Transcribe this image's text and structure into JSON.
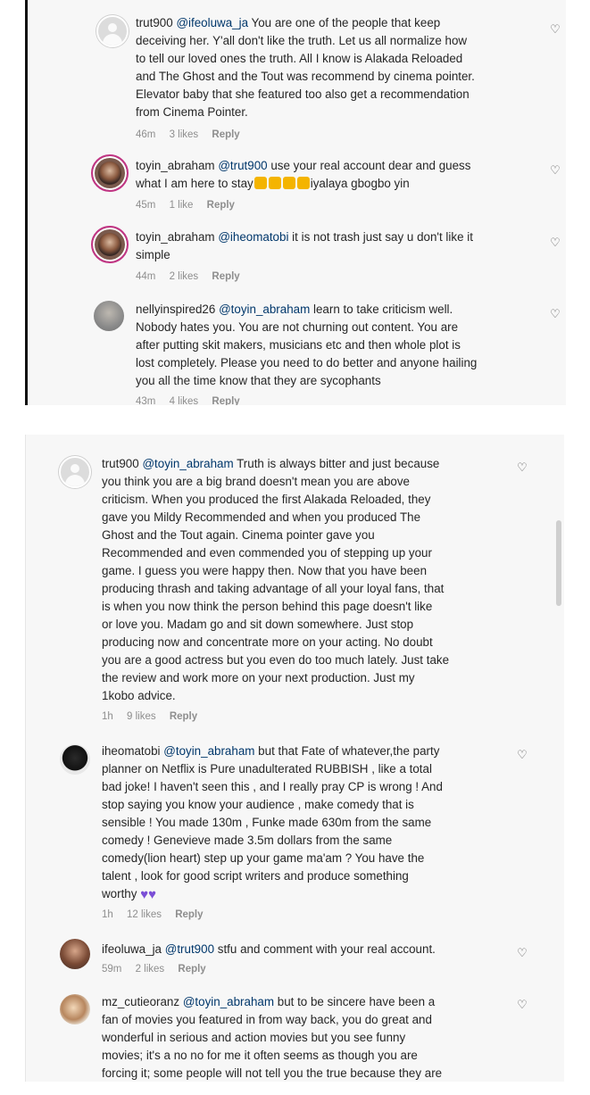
{
  "top_comments": [
    {
      "username": "trut900",
      "mention": "@ifeoluwa_ja",
      "lines": [
        "You are one of the people that keep",
        "deceiving her. Y'all don't like the truth. Let us all normalize how",
        "to tell our loved ones the truth. All I know is Alakada Reloaded",
        "and The Ghost and the Tout was recommend by cinema pointer.",
        "Elevator baby that she featured too also get a recommendation",
        "from Cinema Pointer."
      ],
      "time": "46m",
      "likes": "3 likes",
      "reply": "Reply"
    },
    {
      "username": "toyin_abraham",
      "mention": "@trut900",
      "lines": [
        "use your real account dear and guess",
        "what I am here to stay",
        "iyalaya gbogbo yin"
      ],
      "time": "45m",
      "likes": "1 like",
      "reply": "Reply"
    },
    {
      "username": "toyin_abraham",
      "mention": "@iheomatobi",
      "lines": [
        "it is not trash just say u don't like it",
        "simple"
      ],
      "time": "44m",
      "likes": "2 likes",
      "reply": "Reply"
    },
    {
      "username": "nellyinspired26",
      "mention": "@toyin_abraham",
      "lines": [
        "learn to take criticism well.",
        "Nobody hates you. You are not churning out content. You are",
        "after putting skit makers, musicians etc and then whole plot is",
        "lost completely. Please you need to do better and anyone hailing",
        "you all the time know that they are sycophants"
      ],
      "time": "43m",
      "likes": "4 likes",
      "reply": "Reply"
    }
  ],
  "bottom_comments": [
    {
      "username": "trut900",
      "mention": "@toyin_abraham",
      "lines": [
        "Truth is always bitter and just because",
        "you think you are a big brand doesn't mean you are above",
        "criticism. When you produced the first Alakada Reloaded, they",
        "gave you Mildy Recommended and when you produced The",
        "Ghost and the Tout again. Cinema pointer gave you",
        "Recommended and even commended you of stepping up your",
        "game. I guess you were happy then. Now that you have been",
        "producing thrash and taking advantage of all your loyal fans, that",
        "is when you now think the person behind this page doesn't like",
        "or love you. Madam go and sit down somewhere. Just stop",
        "producing now and concentrate more on your acting. No doubt",
        "you are a good actress but you even do too much lately. Just take",
        "the review and work more on your next production. Just my",
        "1kobo advice."
      ],
      "time": "1h",
      "likes": "9 likes",
      "reply": "Reply"
    },
    {
      "username": "iheomatobi",
      "mention": "@toyin_abraham",
      "lines": [
        "but that Fate of whatever,the party",
        "planner on Netflix is Pure unadulterated RUBBISH , like a total",
        "bad joke! I haven't seen this , and I really pray CP is wrong ! And",
        "stop saying you know your audience , make comedy that is",
        "sensible ! You made 130m , Funke made 630m from the same",
        "comedy ! Genevieve made 3.5m dollars from the same",
        "comedy(lion heart) step up your game ma'am ? You have the",
        "talent , look for good script writers and produce something",
        "worthy"
      ],
      "time": "1h",
      "likes": "12 likes",
      "reply": "Reply"
    },
    {
      "username": "ifeoluwa_ja",
      "mention": "@trut900",
      "lines": [
        "stfu and comment with your real account."
      ],
      "time": "59m",
      "likes": "2 likes",
      "reply": "Reply"
    },
    {
      "username": "mz_cutieoranz",
      "mention": "@toyin_abraham",
      "lines": [
        "but to be sincere have been a",
        "fan of movies you featured in from way back, you do great and",
        "wonderful in serious and action movies but you see funny",
        "movies; it's a no no for me it often seems as though you are",
        "forcing it; some people will not tell you the true because they are"
      ]
    }
  ],
  "icons": {
    "like": "heart-outline-icon"
  },
  "colors": {
    "mention": "#00376b",
    "meta": "#8e8e8e",
    "story_ring": "#c13584"
  }
}
